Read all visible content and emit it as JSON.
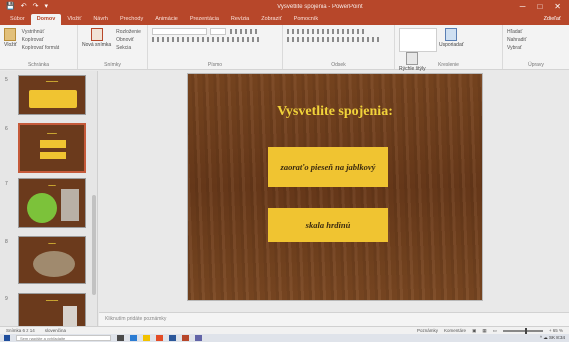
{
  "titlebar": {
    "qat": [
      "💾",
      "↶",
      "↷",
      "▾"
    ],
    "title": "Vysvetlite spojenia - PowerPoint",
    "controls": [
      "─",
      "□",
      "✕"
    ]
  },
  "ribbon": {
    "tabs": [
      "Súbor",
      "Domov",
      "Vložiť",
      "Návrh",
      "Prechody",
      "Animácie",
      "Prezentácia",
      "Revízia",
      "Zobraziť",
      "Pomocník"
    ],
    "active_tab": "Domov",
    "share": "Zdieľať",
    "groups": {
      "clipboard": {
        "paste": "Vložiť",
        "cut": "Vystrihnúť",
        "copy": "Kopírovať",
        "painter": "Kopírovať formát",
        "label": "Schránka"
      },
      "slides": {
        "new_slide": "Nová snímka",
        "layout": "Rozloženie",
        "reset": "Obnoviť",
        "section": "Sekcia",
        "label": "Snímky"
      },
      "font": {
        "label": "Písmo"
      },
      "paragraph": {
        "label": "Odsek"
      },
      "drawing": {
        "shapes": "Tvary",
        "arrange": "Usporiadať",
        "styles": "Rýchle štýly",
        "label": "Kreslenie"
      },
      "editing": {
        "find": "Hľadať",
        "replace": "Nahradiť",
        "select": "Vybrať",
        "label": "Úpravy"
      }
    }
  },
  "thumbnails": [
    {
      "num": "5"
    },
    {
      "num": "6"
    },
    {
      "num": "7"
    },
    {
      "num": "8"
    },
    {
      "num": "9"
    }
  ],
  "slide": {
    "title": "Vysvetlite spojenia:",
    "box1": "zaoraťo pieseň na jablkový",
    "box2": "skala hrdinú"
  },
  "notes": {
    "placeholder": "Kliknutím pridáte poznámky"
  },
  "statusbar": {
    "slide_info": "Snímka 6 z 14",
    "language": "slovenčina",
    "notes_btn": "Poznámky",
    "comments_btn": "Komentáre",
    "zoom": "+ 65 %"
  },
  "taskbar": {
    "search": "Sem napíšte a vyhľadajte",
    "tray": "^ ☁ SK 8:34"
  }
}
